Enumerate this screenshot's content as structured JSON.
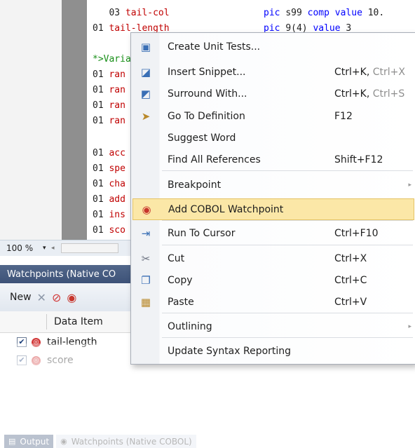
{
  "editor": {
    "lines": [
      {
        "num": "",
        "parts": [
          {
            "t": "   03 ",
            "c": "kw-num"
          },
          {
            "t": "tail-col",
            "c": "kw-red"
          }
        ],
        "tail": [
          {
            "t": "pic ",
            "c": "kw-blue"
          },
          {
            "t": "s99 ",
            "c": "kw-num"
          },
          {
            "t": "comp ",
            "c": "kw-blue"
          },
          {
            "t": "value ",
            "c": "kw-blue"
          },
          {
            "t": "10.",
            "c": "kw-num"
          }
        ]
      },
      {
        "num": "",
        "parts": [
          {
            "t": "01 ",
            "c": "kw-num"
          },
          {
            "t": "tail-length",
            "c": "kw-red"
          }
        ],
        "tail": [
          {
            "t": "pic ",
            "c": "kw-blue"
          },
          {
            "t": "9(4) ",
            "c": "kw-num"
          },
          {
            "t": "value ",
            "c": "kw-blue"
          },
          {
            "t": "3",
            "c": "kw-num"
          }
        ]
      },
      {
        "num": "",
        "parts": [
          {
            "t": "*>Varia",
            "c": "kw-green"
          }
        ],
        "tail": []
      },
      {
        "num": "",
        "parts": [
          {
            "t": "01 ",
            "c": "kw-num"
          },
          {
            "t": "ran",
            "c": "kw-red"
          }
        ],
        "tail": []
      },
      {
        "num": "",
        "parts": [
          {
            "t": "01 ",
            "c": "kw-num"
          },
          {
            "t": "ran",
            "c": "kw-red"
          }
        ],
        "tail": []
      },
      {
        "num": "",
        "parts": [
          {
            "t": "01 ",
            "c": "kw-num"
          },
          {
            "t": "ran",
            "c": "kw-red"
          }
        ],
        "tail": []
      },
      {
        "num": "",
        "parts": [
          {
            "t": "01 ",
            "c": "kw-num"
          },
          {
            "t": "ran",
            "c": "kw-red"
          }
        ],
        "tail": []
      },
      {
        "num": "",
        "parts": [
          {
            "t": "01 ",
            "c": "kw-num"
          },
          {
            "t": "acc",
            "c": "kw-red"
          }
        ],
        "tail": []
      },
      {
        "num": "",
        "parts": [
          {
            "t": "01 ",
            "c": "kw-num"
          },
          {
            "t": "spe",
            "c": "kw-red"
          }
        ],
        "tail": []
      },
      {
        "num": "",
        "parts": [
          {
            "t": "01 ",
            "c": "kw-num"
          },
          {
            "t": "cha",
            "c": "kw-red"
          }
        ],
        "tail": []
      },
      {
        "num": "",
        "parts": [
          {
            "t": "01 ",
            "c": "kw-num"
          },
          {
            "t": "add",
            "c": "kw-red"
          }
        ],
        "tail": []
      },
      {
        "num": "",
        "parts": [
          {
            "t": "01 ",
            "c": "kw-num"
          },
          {
            "t": "ins",
            "c": "kw-red"
          }
        ],
        "tail": []
      },
      {
        "num": "",
        "parts": [
          {
            "t": "01 ",
            "c": "kw-num"
          },
          {
            "t": "sco",
            "c": "kw-red"
          }
        ],
        "tail": []
      }
    ],
    "zoom": "100 %"
  },
  "watchpoints": {
    "title": "Watchpoints (Native CO",
    "new_label": "New",
    "column_data_item": "Data Item",
    "rows": [
      {
        "name": "tail-length",
        "checked": true
      },
      {
        "name": "score",
        "checked": true
      }
    ]
  },
  "bottom_tabs": {
    "output": "Output",
    "watchpoints": "Watchpoints (Native COBOL)"
  },
  "context_menu": {
    "items": [
      {
        "id": "create-unit-tests",
        "label": "Create Unit Tests...",
        "shortcut": "",
        "shortcut_faded": "",
        "icon": "unit-test-icon"
      },
      {
        "id": "insert-snippet",
        "label": "Insert Snippet...",
        "shortcut": "Ctrl+K, ",
        "shortcut_faded": "Ctrl+X",
        "icon": "snippet-icon"
      },
      {
        "id": "surround-with",
        "label": "Surround With...",
        "shortcut": "Ctrl+K, ",
        "shortcut_faded": "Ctrl+S",
        "icon": "surround-icon"
      },
      {
        "id": "go-to-definition",
        "label": "Go To Definition",
        "shortcut": "F12",
        "shortcut_faded": "",
        "icon": "definition-icon"
      },
      {
        "id": "suggest-word",
        "label": "Suggest Word",
        "shortcut": "",
        "shortcut_faded": "",
        "icon": ""
      },
      {
        "id": "find-all-references",
        "label": "Find All References",
        "shortcut": "Shift+F12",
        "shortcut_faded": "",
        "icon": ""
      },
      {
        "id": "breakpoint",
        "label": "Breakpoint",
        "shortcut": "",
        "shortcut_faded": "",
        "icon": "",
        "submenu": true
      },
      {
        "id": "add-cobol-watchpoint",
        "label": "Add COBOL Watchpoint",
        "shortcut": "",
        "shortcut_faded": "",
        "icon": "watchpoint-icon",
        "highlight": true
      },
      {
        "id": "run-to-cursor",
        "label": "Run To Cursor",
        "shortcut": "Ctrl+F10",
        "shortcut_faded": "",
        "icon": "run-to-cursor-icon"
      },
      {
        "id": "cut",
        "label": "Cut",
        "shortcut": "Ctrl+X",
        "shortcut_faded": "",
        "icon": "scissors-icon"
      },
      {
        "id": "copy",
        "label": "Copy",
        "shortcut": "Ctrl+C",
        "shortcut_faded": "",
        "icon": "copy-icon"
      },
      {
        "id": "paste",
        "label": "Paste",
        "shortcut": "Ctrl+V",
        "shortcut_faded": "",
        "icon": "paste-icon"
      },
      {
        "id": "outlining",
        "label": "Outlining",
        "shortcut": "",
        "shortcut_faded": "",
        "icon": "",
        "submenu": true
      },
      {
        "id": "update-syntax-reporting",
        "label": "Update Syntax Reporting",
        "shortcut": "",
        "shortcut_faded": "",
        "icon": ""
      }
    ]
  }
}
